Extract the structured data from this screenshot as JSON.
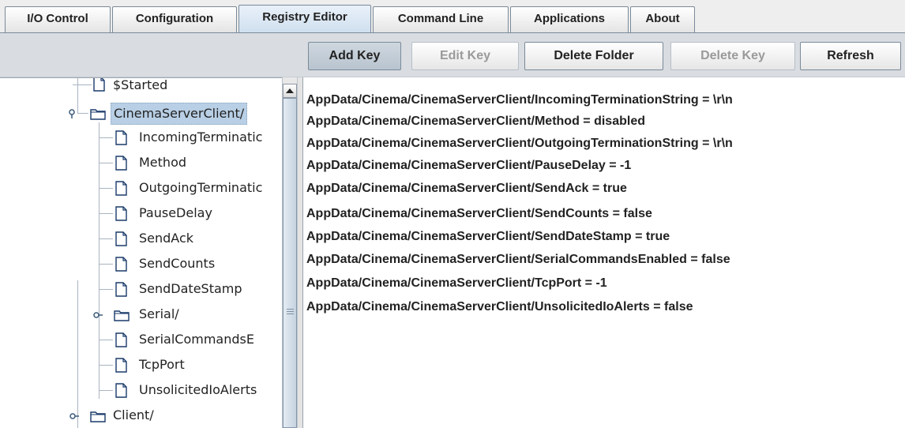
{
  "tabs": [
    {
      "label": "I/O Control"
    },
    {
      "label": "Configuration"
    },
    {
      "label": "Registry Editor"
    },
    {
      "label": "Command Line"
    },
    {
      "label": "Applications"
    },
    {
      "label": "About"
    }
  ],
  "active_tab": "Registry Editor",
  "toolbar": {
    "add_key": "Add Key",
    "edit_key": "Edit Key",
    "delete_folder": "Delete Folder",
    "delete_key": "Delete Key",
    "refresh": "Refresh"
  },
  "tree": {
    "nodes": [
      {
        "label": "$Started",
        "type": "file"
      },
      {
        "label": "CinemaServerClient/",
        "type": "folder",
        "expanded": true,
        "selected": true
      },
      {
        "label": "IncomingTerminatic",
        "type": "file"
      },
      {
        "label": "Method",
        "type": "file"
      },
      {
        "label": "OutgoingTerminatic",
        "type": "file"
      },
      {
        "label": "PauseDelay",
        "type": "file"
      },
      {
        "label": "SendAck",
        "type": "file"
      },
      {
        "label": "SendCounts",
        "type": "file"
      },
      {
        "label": "SendDateStamp",
        "type": "file"
      },
      {
        "label": "Serial/",
        "type": "folder",
        "expanded": false
      },
      {
        "label": "SerialCommandsE",
        "type": "file"
      },
      {
        "label": "TcpPort",
        "type": "file"
      },
      {
        "label": "UnsolicitedIoAlerts",
        "type": "file"
      },
      {
        "label": "Client/",
        "type": "folder",
        "expanded": false
      }
    ]
  },
  "content": {
    "lines": [
      "AppData/Cinema/CinemaServerClient/IncomingTerminationString = \\r\\n",
      "AppData/Cinema/CinemaServerClient/Method = disabled",
      "AppData/Cinema/CinemaServerClient/OutgoingTerminationString = \\r\\n",
      "AppData/Cinema/CinemaServerClient/PauseDelay = -1",
      "AppData/Cinema/CinemaServerClient/SendAck = true",
      "AppData/Cinema/CinemaServerClient/SendCounts = false",
      "AppData/Cinema/CinemaServerClient/SendDateStamp = true",
      "AppData/Cinema/CinemaServerClient/SerialCommandsEnabled = false",
      "AppData/Cinema/CinemaServerClient/TcpPort = -1",
      "AppData/Cinema/CinemaServerClient/UnsolicitedIoAlerts = false"
    ]
  },
  "colors": {
    "selection": "#b8cfe5",
    "active_tab": "#cfdfee",
    "toolbar_bg": "#d9dde2"
  }
}
